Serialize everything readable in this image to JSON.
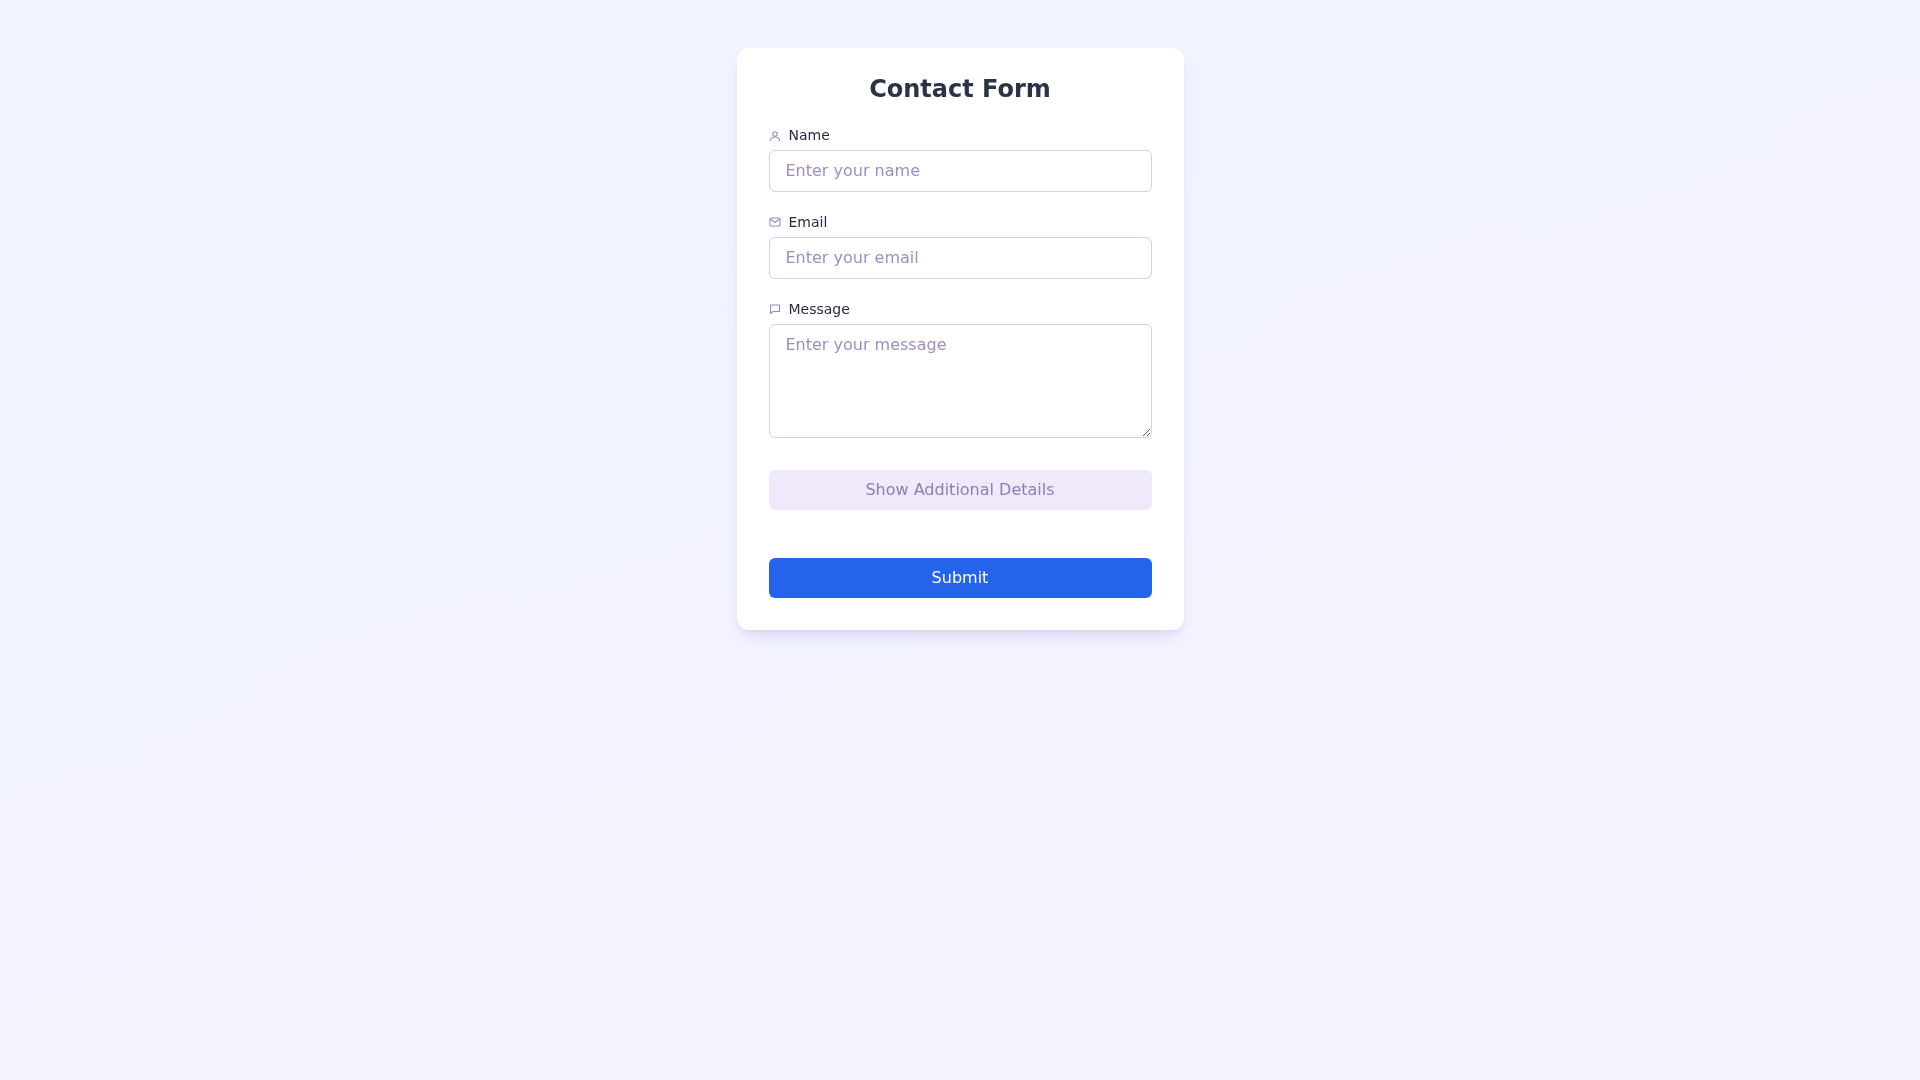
{
  "form": {
    "title": "Contact Form",
    "fields": [
      {
        "kind": "name",
        "label": "Name",
        "placeholder": "Enter your name"
      },
      {
        "kind": "email",
        "label": "Email",
        "placeholder": "Enter your email"
      },
      {
        "kind": "message",
        "label": "Message",
        "placeholder": "Enter your message"
      }
    ],
    "details_button": "Show Additional Details",
    "submit_button": "Submit"
  }
}
